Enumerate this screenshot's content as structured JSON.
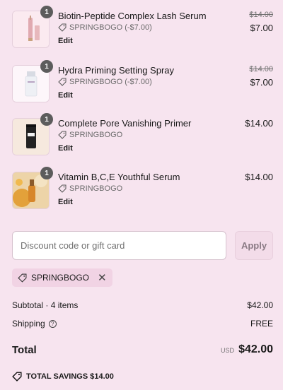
{
  "items": [
    {
      "name": "Biotin-Peptide Complex Lash Serum",
      "quantity": "1",
      "discount": "SPRINGBOGO (-$7.00)",
      "edit": "Edit",
      "original_price": "$14.00",
      "price": "$7.00",
      "image": "lash-serum-icon"
    },
    {
      "name": "Hydra Priming Setting Spray",
      "quantity": "1",
      "discount": "SPRINGBOGO (-$7.00)",
      "edit": "Edit",
      "original_price": "$14.00",
      "price": "$7.00",
      "image": "setting-spray-icon"
    },
    {
      "name": "Complete Pore Vanishing Primer",
      "quantity": "1",
      "discount": "SPRINGBOGO",
      "edit": "Edit",
      "price": "$14.00",
      "image": "primer-icon"
    },
    {
      "name": "Vitamin B,C,E Youthful Serum",
      "quantity": "1",
      "discount": "SPRINGBOGO",
      "edit": "Edit",
      "price": "$14.00",
      "image": "vitamin-serum-icon"
    }
  ],
  "discount_field": {
    "placeholder": "Discount code or gift card",
    "value": "",
    "apply_label": "Apply"
  },
  "applied_code": {
    "code": "SPRINGBOGO",
    "remove_icon": "close-icon"
  },
  "summary": {
    "subtotal_label": "Subtotal · 4 items",
    "subtotal_value": "$42.00",
    "shipping_label": "Shipping",
    "shipping_value": "FREE",
    "total_label": "Total",
    "currency": "USD",
    "total_value": "$42.00",
    "savings_label": "TOTAL SAVINGS $14.00"
  },
  "colors": {
    "background": "#f7e4ef",
    "qty_badge": "#5c5c5c",
    "apply_button": "#f3dce9",
    "chip": "#f1d3e4"
  }
}
